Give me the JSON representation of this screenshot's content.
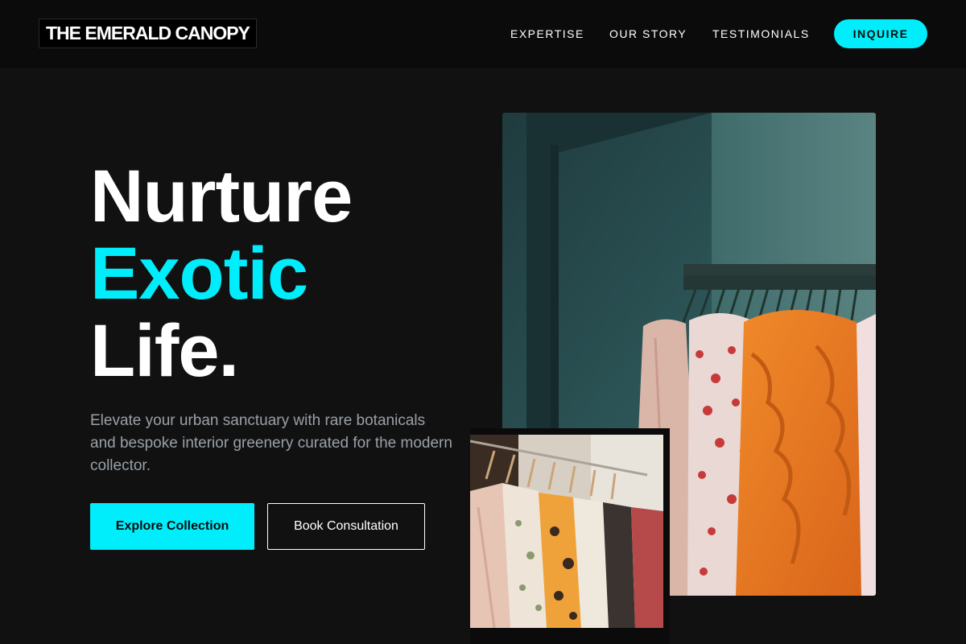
{
  "header": {
    "logo": "THE EMERALD CANOPY",
    "nav": [
      {
        "label": "EXPERTISE"
      },
      {
        "label": "OUR STORY"
      },
      {
        "label": "TESTIMONIALS"
      }
    ],
    "cta_label": "INQUIRE"
  },
  "hero": {
    "headline": {
      "line1": "Nurture",
      "line2": "Exotic",
      "line3": "Life."
    },
    "subtext": "Elevate your urban sanctuary with rare botanicals and bespoke interior greenery curated for the modern collector.",
    "primary_button": "Explore Collection",
    "secondary_button": "Book Consultation"
  },
  "images": {
    "main": {
      "icon": "clothing-rack-photo"
    },
    "thumbnail": {
      "icon": "clothing-rack-closeup-photo"
    }
  },
  "colors": {
    "accent": "#00eefc",
    "background": "#111111",
    "header": "#0b0b0b",
    "muted_text": "#9aa0a8"
  }
}
